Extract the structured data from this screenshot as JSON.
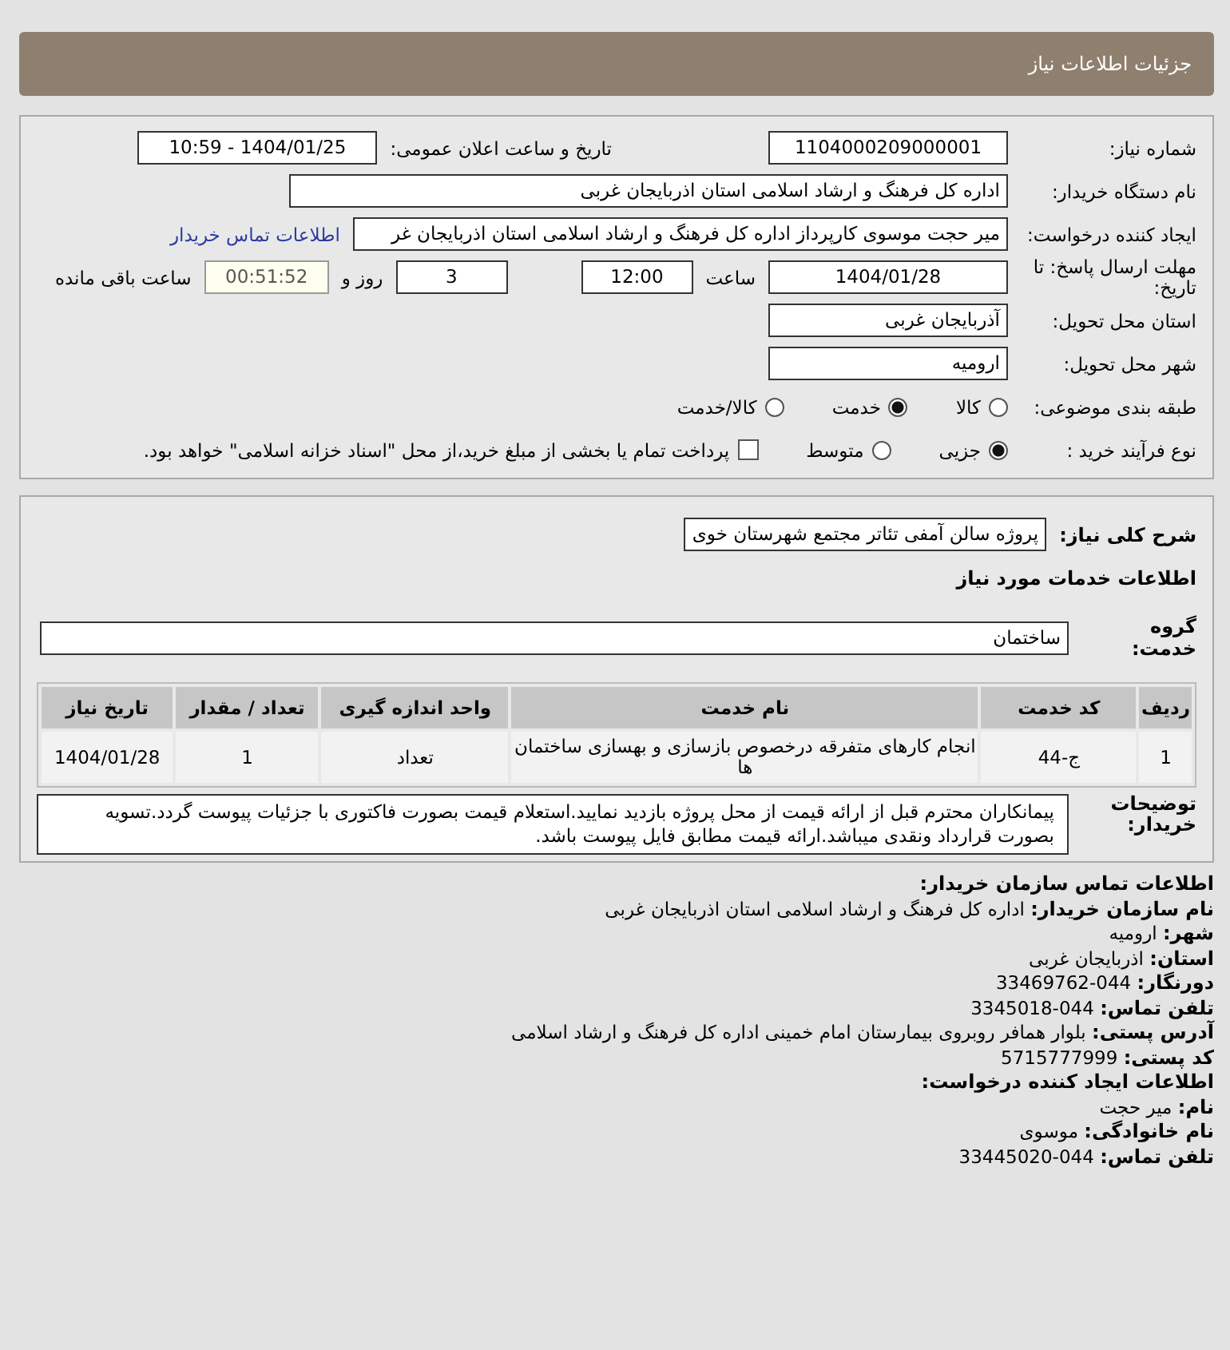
{
  "header": {
    "title": "جزئیات اطلاعات نیاز"
  },
  "details": {
    "need_number": {
      "label": "شماره نیاز:",
      "value": "1104000209000001"
    },
    "announce": {
      "label": "تاریخ و ساعت اعلان عمومی:",
      "value": "1404/01/25 - 10:59"
    },
    "buyer_org": {
      "label": "نام دستگاه خریدار:",
      "value": "اداره کل فرهنگ و ارشاد اسلامی استان اذربایجان غربی"
    },
    "requester": {
      "label": "ایجاد کننده درخواست:",
      "value": "میر حجت موسوی کارپرداز اداره کل فرهنگ و ارشاد اسلامی استان اذربایجان غر",
      "link": "اطلاعات تماس خریدار"
    },
    "deadline": {
      "label": "مهلت ارسال پاسخ: تا تاریخ:",
      "date": "1404/01/28",
      "time_label": "ساعت",
      "time": "12:00",
      "days": "3",
      "days_label": "روز و",
      "remaining": "00:51:52",
      "remaining_label": "ساعت باقی مانده"
    },
    "province": {
      "label": "استان محل تحویل:",
      "value": "آذربایجان غربی"
    },
    "city": {
      "label": "شهر محل تحویل:",
      "value": "ارومیه"
    },
    "category": {
      "label": "طبقه بندی موضوعی:",
      "options": [
        {
          "label": "کالا",
          "selected": false
        },
        {
          "label": "خدمت",
          "selected": true
        },
        {
          "label": "کالا/خدمت",
          "selected": false
        }
      ]
    },
    "process": {
      "label": "نوع فرآیند خرید :",
      "options": [
        {
          "label": "جزیی",
          "selected": true
        },
        {
          "label": "متوسط",
          "selected": false
        }
      ],
      "checkbox": {
        "label": "پرداخت تمام یا بخشی از مبلغ خرید،از محل \"اسناد خزانه اسلامی\" خواهد بود.",
        "checked": false
      }
    }
  },
  "need": {
    "summary": {
      "label": "شرح کلی نیاز:",
      "value": "پروژه سالن آمفی تئاتر مجتمع شهرستان خوی"
    },
    "services_title": "اطلاعات خدمات مورد نیاز",
    "service_group": {
      "label": "گروه خدمت:",
      "value": "ساختمان"
    },
    "table": {
      "columns": [
        "ردیف",
        "کد خدمت",
        "نام خدمت",
        "واحد اندازه گیری",
        "تعداد / مقدار",
        "تاریخ نیاز"
      ],
      "rows": [
        [
          "1",
          "ج-44",
          "انجام کارهای متفرقه درخصوص بازسازی و بهسازی ساختمان ها",
          "تعداد",
          "1",
          "1404/01/28"
        ]
      ]
    },
    "buyer_notes": {
      "label": "توضیحات خریدار:",
      "value": "پیمانکاران محترم قبل از ارائه قیمت از محل پروژه بازدید نمایید.استعلام قیمت بصورت فاکتوری با جزئیات پیوست گردد.تسویه بصورت قرارداد ونقدی میباشد.ارائه قیمت مطابق فایل پیوست باشد."
    }
  },
  "contact": [
    {
      "title": "اطلاعات تماس سازمان خریدار:",
      "lines": [
        {
          "label": "نام سازمان خریدار:",
          "value": "اداره کل فرهنگ و ارشاد اسلامی استان اذربایجان غربی"
        },
        {
          "label": "شهر:",
          "value": "ارومیه"
        },
        {
          "label": "استان:",
          "value": "اذربایجان غربی"
        },
        {
          "label": "دورنگار:",
          "value": "044-33469762"
        },
        {
          "label": "تلفن تماس:",
          "value": "044-3345018"
        },
        {
          "label": "آدرس پستی:",
          "value": "بلوار همافر روبروی بیمارستان امام خمینی اداره کل فرهنگ و ارشاد اسلامی"
        },
        {
          "label": "کد پستی:",
          "value": "5715777999"
        }
      ]
    },
    {
      "title": "اطلاعات ایجاد کننده درخواست:",
      "lines": [
        {
          "label": "نام:",
          "value": "میر حجت"
        },
        {
          "label": "نام خانوادگی:",
          "value": "موسوی"
        },
        {
          "label": "تلفن تماس:",
          "value": "044-33445020"
        }
      ]
    }
  ]
}
